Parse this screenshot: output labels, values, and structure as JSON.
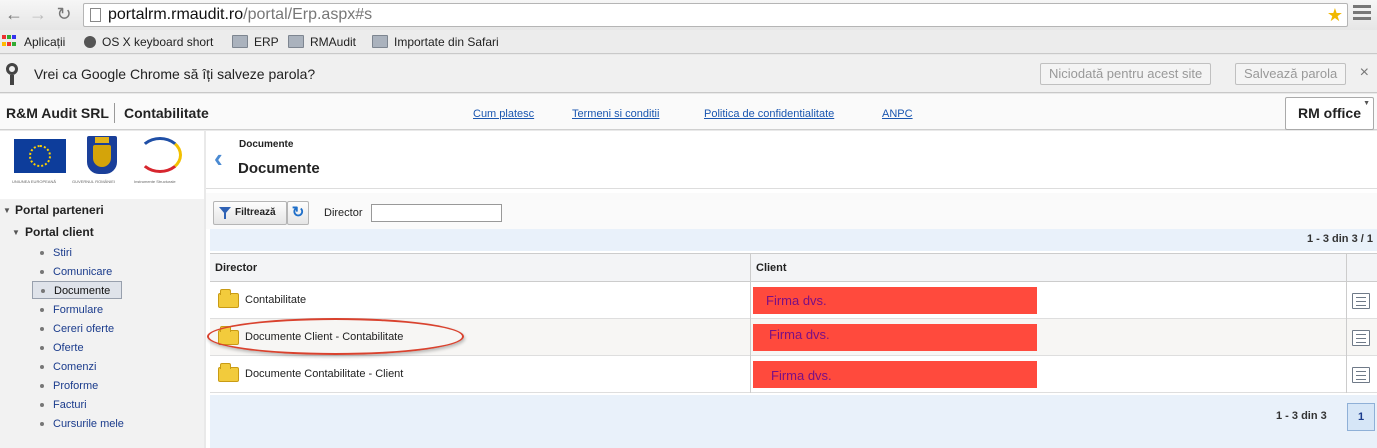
{
  "browser": {
    "url_host": "portalrm.rmaudit.ro",
    "url_path": "/portal/Erp.aspx#s",
    "bookmarks": [
      "Aplicații",
      "OS X keyboard short",
      "ERP",
      "RMAudit",
      "Importate din Safari"
    ]
  },
  "infobar": {
    "message": "Vrei ca Google Chrome să îți salveze parola?",
    "never_label": "Niciodată pentru acest site",
    "save_label": "Salvează parola"
  },
  "header": {
    "company": "R&M Audit SRL",
    "module": "Contabilitate",
    "links": [
      "Cum platesc",
      "Termeni si conditii",
      "Politica de confidentialitate",
      "ANPC"
    ],
    "app_menu": "RM office"
  },
  "sidebar": {
    "logo_captions": [
      "UNIUNEA EUROPEANĂ",
      "GUVERNUL ROMÂNIEI",
      "Instrumente Structurale"
    ],
    "root": "Portal parteneri",
    "section": "Portal client",
    "items": [
      "Stiri",
      "Comunicare",
      "Documente",
      "Formulare",
      "Cereri oferte",
      "Oferte",
      "Comenzi",
      "Proforme",
      "Facturi",
      "Cursurile mele"
    ],
    "active_item": "Documente"
  },
  "page": {
    "breadcrumb": "Documente",
    "title": "Documente"
  },
  "filter": {
    "button_label": "Filtrează",
    "field_label": "Director",
    "field_value": ""
  },
  "grid": {
    "pager_top": "1 - 3 din 3 /  1",
    "columns": [
      "Director",
      "Client"
    ],
    "rows": [
      {
        "director": "Contabilitate",
        "client": "Firma dvs."
      },
      {
        "director": "Documente Client - Contabilitate",
        "client": "Firma dvs."
      },
      {
        "director": "Documente Contabilitate - Client",
        "client": "Firma dvs."
      }
    ],
    "pager_bottom": "1 - 3 din 3",
    "current_page": "1"
  },
  "colors": {
    "client_highlight": "#ff4a3d",
    "annotation_oval": "#d9422e",
    "link": "#1a56b0"
  }
}
